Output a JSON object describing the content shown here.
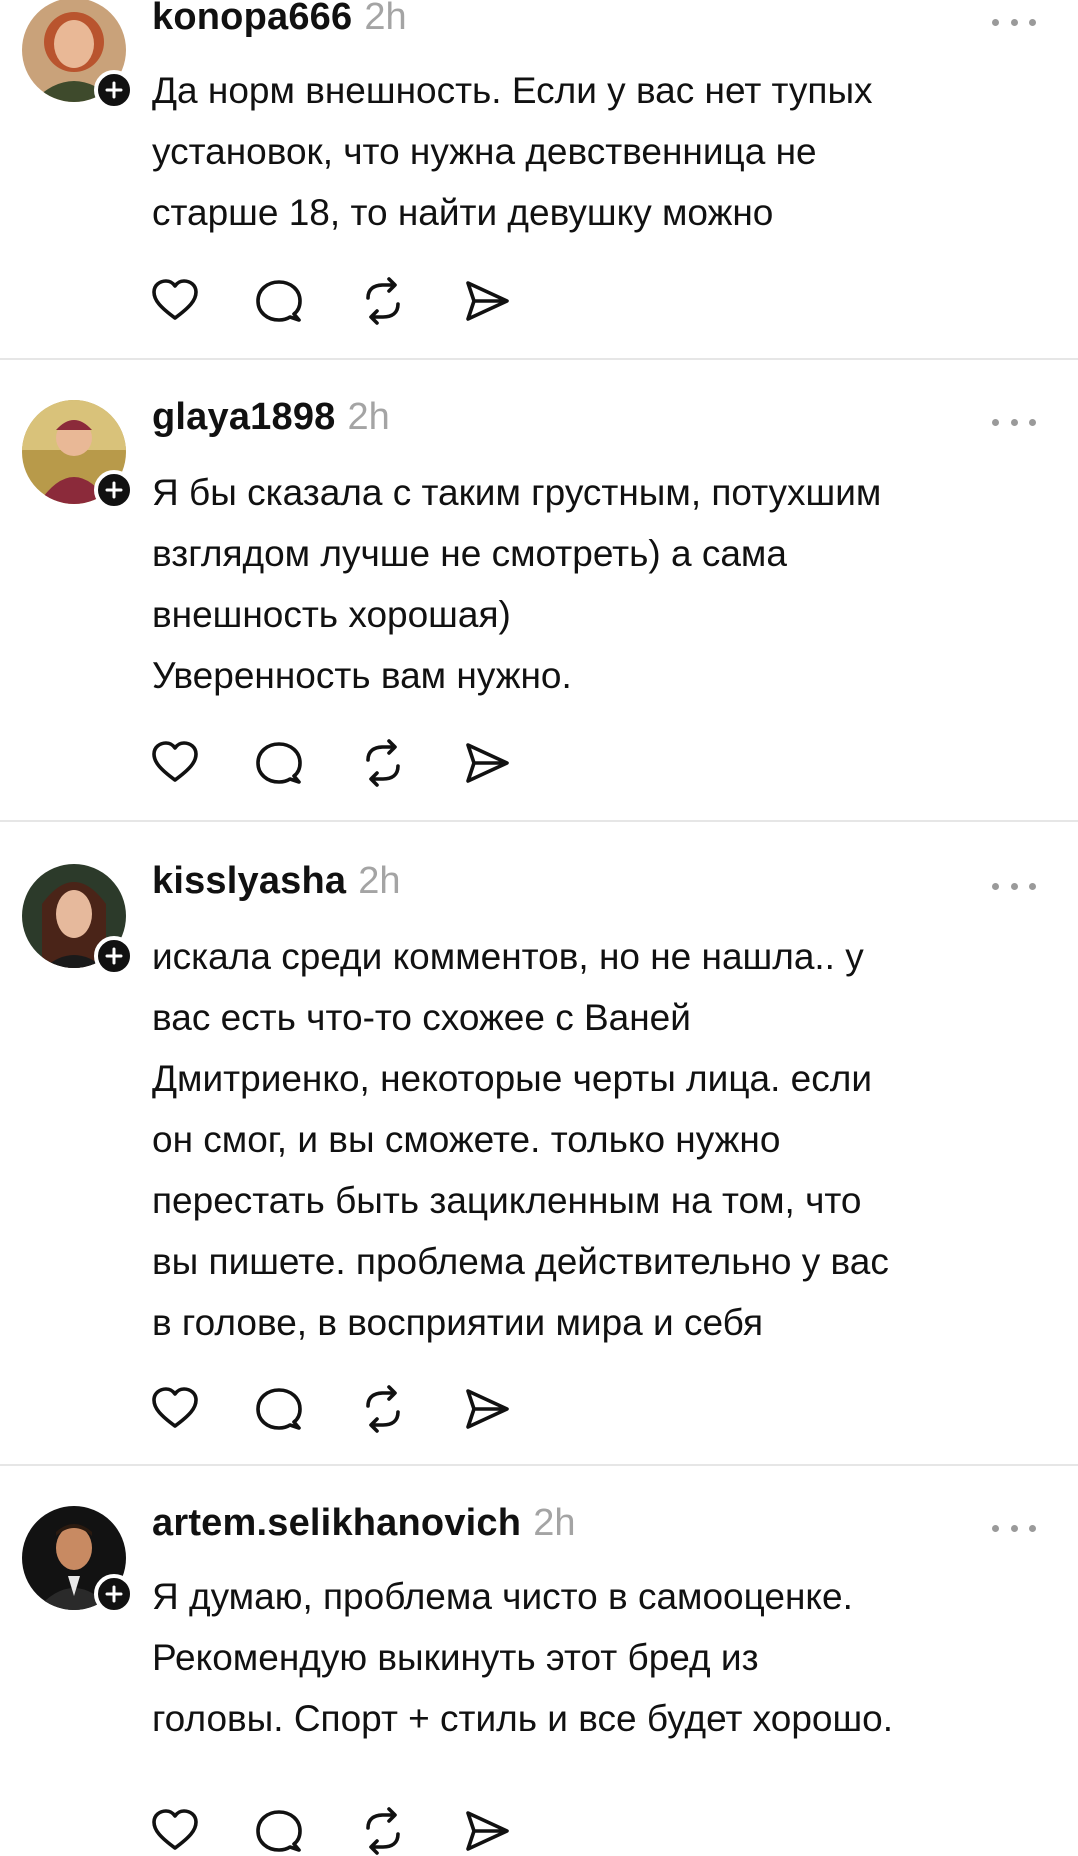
{
  "comments": [
    {
      "username": "konopa666",
      "time": "2h",
      "text": "Да норм внешность. Если у вас нет тупых\nустановок, что нужна девственница не\nстарше 18, то найти девушку можно",
      "avatar": "avatar-konopa666"
    },
    {
      "username": "glaya1898",
      "time": "2h",
      "text": "Я бы сказала с таким грустным, потухшим\nвзглядом лучше не смотреть) а сама\nвнешность хорошая)\nУверенность вам нужно.",
      "avatar": "avatar-glaya1898"
    },
    {
      "username": "kisslyasha",
      "time": "2h",
      "text": "искала среди комментов, но не нашла.. у\nвас есть что-то схожее с Ваней\nДмитриенко, некоторые черты лица. если\nон смог, и вы сможете. только нужно\nперестать быть зацикленным на том, что\nвы пишете. проблема действительно у вас\nв голове, в восприятии мира и себя",
      "avatar": "avatar-kisslyasha"
    },
    {
      "username": "artem.selikhanovich",
      "time": "2h",
      "text": "Я думаю, проблема чисто в самооценке.\nРекомендую выкинуть этот бред из\nголовы. Спорт + стиль и все будет хорошо.",
      "avatar": "avatar-artem"
    }
  ],
  "icons": {
    "like": "heart-icon",
    "reply": "comment-icon",
    "repost": "repost-icon",
    "share": "send-icon",
    "more": "more-icon",
    "follow": "plus-icon"
  }
}
